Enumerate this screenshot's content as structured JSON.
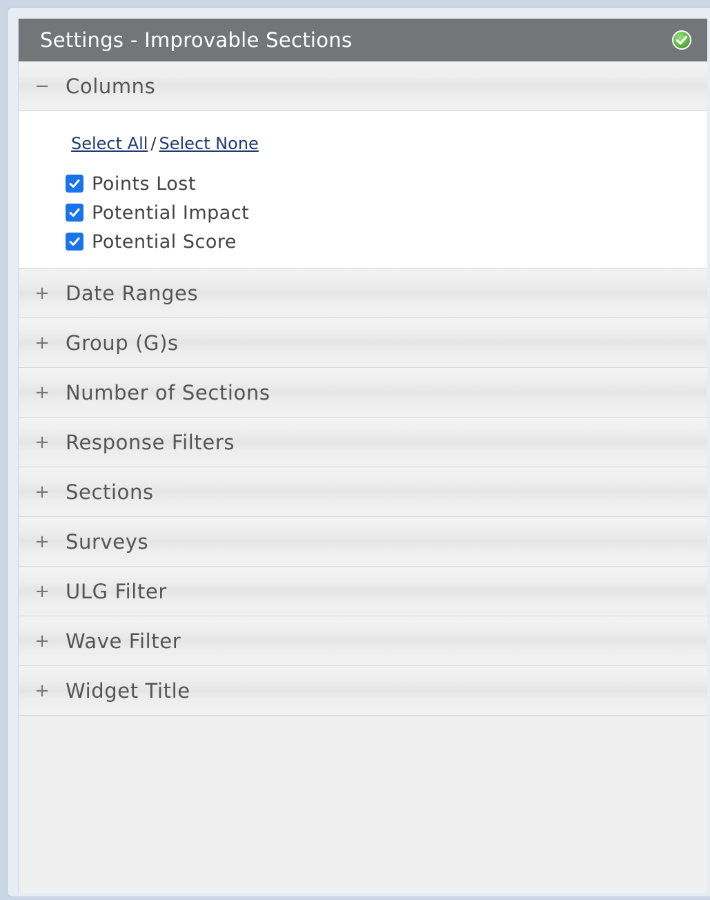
{
  "title": "Settings - Improvable Sections",
  "header_icon": "check-circle-icon",
  "colors": {
    "titlebar": "#737679",
    "checkbox": "#1a73e8",
    "link": "#1f3b73",
    "confirm": "#5fbf3f"
  },
  "columns_section": {
    "label": "Columns",
    "toggle": "−",
    "expanded": true,
    "select_all": "Select All",
    "separator": "/",
    "select_none": "Select None",
    "options": [
      {
        "label": "Points Lost",
        "checked": true
      },
      {
        "label": "Potential Impact",
        "checked": true
      },
      {
        "label": "Potential Score",
        "checked": true
      }
    ]
  },
  "collapsed_sections": [
    {
      "label": "Date Ranges",
      "toggle": "+"
    },
    {
      "label": "Group (G)s",
      "toggle": "+"
    },
    {
      "label": "Number of Sections",
      "toggle": "+"
    },
    {
      "label": "Response Filters",
      "toggle": "+"
    },
    {
      "label": "Sections",
      "toggle": "+"
    },
    {
      "label": "Surveys",
      "toggle": "+"
    },
    {
      "label": "ULG Filter",
      "toggle": "+"
    },
    {
      "label": "Wave Filter",
      "toggle": "+"
    },
    {
      "label": "Widget Title",
      "toggle": "+"
    }
  ]
}
